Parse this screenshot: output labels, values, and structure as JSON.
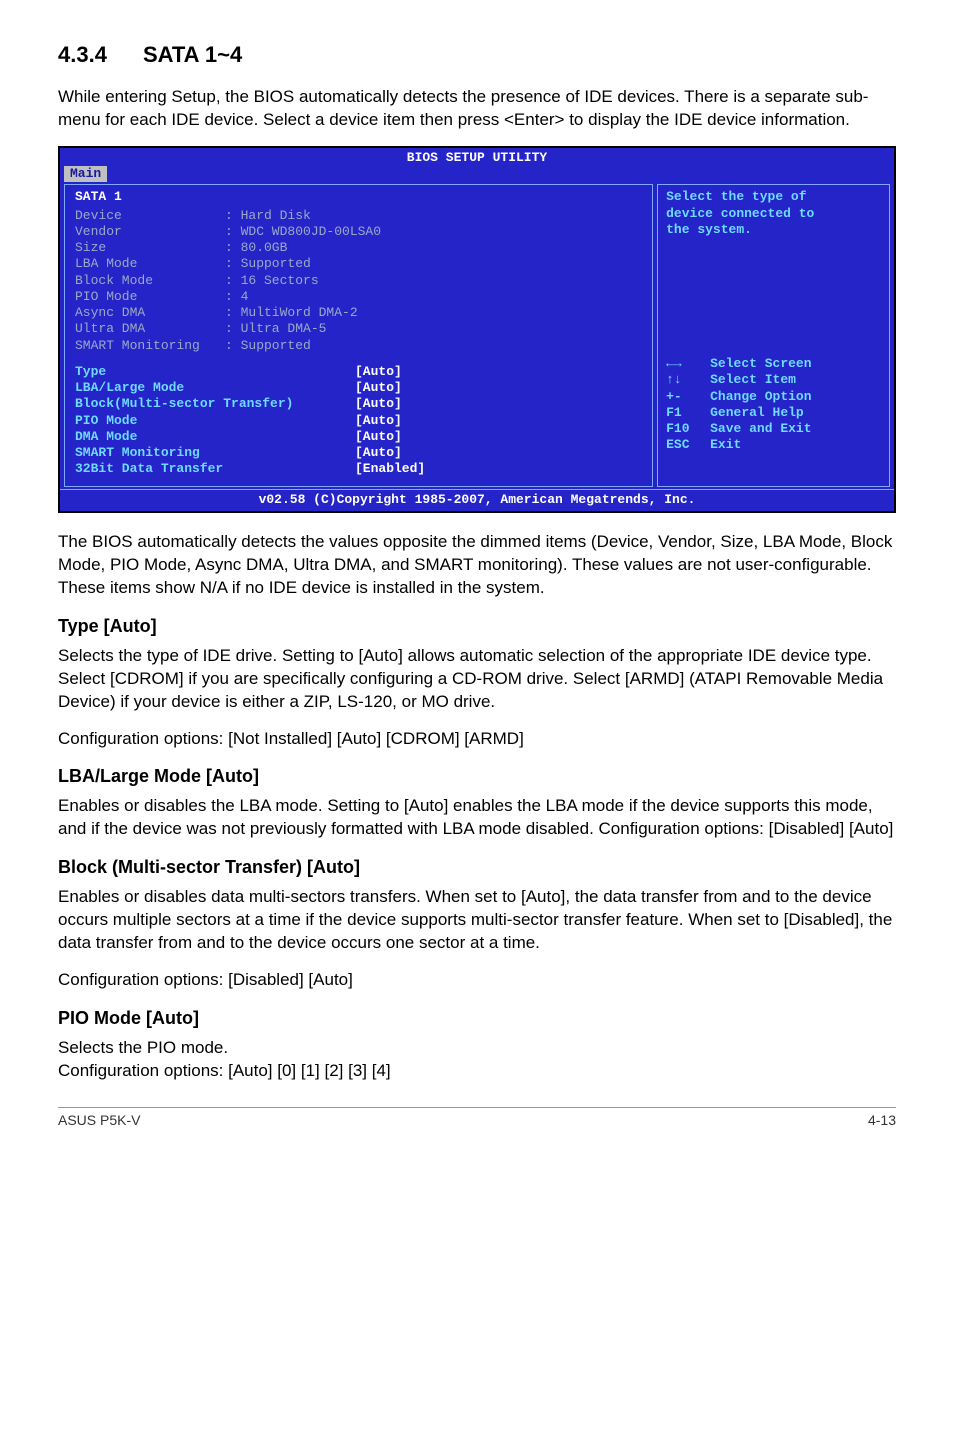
{
  "section": {
    "number": "4.3.4",
    "title": "SATA 1~4"
  },
  "intro": "While entering Setup, the BIOS automatically detects the presence of IDE devices. There is a separate sub-menu for each IDE device. Select a device item then press <Enter> to display the IDE device information.",
  "bios": {
    "title": "BIOS SETUP UTILITY",
    "tab": "Main",
    "panel_title": "SATA 1",
    "info_rows": [
      {
        "label": "Device",
        "value": ": Hard Disk"
      },
      {
        "label": "Vendor",
        "value": ": WDC WD800JD-00LSA0"
      },
      {
        "label": "Size",
        "value": ": 80.0GB"
      },
      {
        "label": "LBA Mode",
        "value": ": Supported"
      },
      {
        "label": "Block Mode",
        "value": ": 16 Sectors"
      },
      {
        "label": "PIO Mode",
        "value": ": 4"
      },
      {
        "label": "Async DMA",
        "value": ": MultiWord DMA-2"
      },
      {
        "label": "Ultra DMA",
        "value": ": Ultra DMA-5"
      },
      {
        "label": "SMART Monitoring",
        "value": ": Supported"
      }
    ],
    "fields": [
      {
        "label": "Type",
        "value": "[Auto]"
      },
      {
        "label": "LBA/Large Mode",
        "value": "[Auto]"
      },
      {
        "label": "Block(Multi-sector Transfer)",
        "value": "[Auto]"
      },
      {
        "label": "PIO Mode",
        "value": "[Auto]"
      },
      {
        "label": "DMA Mode",
        "value": "[Auto]"
      },
      {
        "label": "SMART Monitoring",
        "value": "[Auto]"
      },
      {
        "label": "32Bit Data Transfer",
        "value": "[Enabled]"
      }
    ],
    "side_hint": {
      "line1": "Select the type of",
      "line2": "device connected to",
      "line3": "the system."
    },
    "help": [
      {
        "key": "←→",
        "desc": "Select Screen"
      },
      {
        "key": "↑↓",
        "desc": "Select Item"
      },
      {
        "key": "+-",
        "desc": "Change Option"
      },
      {
        "key": "F1",
        "desc": "General Help"
      },
      {
        "key": "F10",
        "desc": "Save and Exit"
      },
      {
        "key": "ESC",
        "desc": "Exit"
      }
    ],
    "footer": "v02.58 (C)Copyright 1985-2007, American Megatrends, Inc."
  },
  "after_bios": "The BIOS automatically detects the values opposite the dimmed items (Device, Vendor, Size, LBA Mode, Block Mode, PIO Mode, Async DMA, Ultra DMA, and SMART monitoring). These values are not user-configurable. These items show N/A if no IDE device is installed in the system.",
  "type": {
    "heading": "Type [Auto]",
    "para": "Selects the type of IDE drive. Setting to [Auto] allows automatic selection of the appropriate IDE device type. Select [CDROM] if you are specifically configuring a CD-ROM drive. Select [ARMD] (ATAPI Removable Media Device) if your device is either a ZIP, LS-120, or MO drive.",
    "opts": "Configuration options: [Not Installed] [Auto] [CDROM] [ARMD]"
  },
  "lba": {
    "heading": "LBA/Large Mode [Auto]",
    "para": "Enables or disables the LBA mode. Setting to [Auto] enables the LBA mode if the device supports this mode, and if the device was not previously formatted with LBA mode disabled. Configuration options: [Disabled] [Auto]"
  },
  "block": {
    "heading": "Block (Multi-sector Transfer) [Auto]",
    "para": "Enables or disables data multi-sectors transfers. When set to [Auto], the data transfer from and to the device occurs multiple sectors at a time if the device supports multi-sector transfer feature. When set to [Disabled], the data transfer from and to the device occurs one sector at a time.",
    "opts": "Configuration options: [Disabled] [Auto]"
  },
  "pio": {
    "heading": "PIO Mode [Auto]",
    "para": "Selects the PIO mode.",
    "opts": "Configuration options: [Auto] [0] [1] [2] [3] [4]"
  },
  "footer": {
    "left": "ASUS P5K-V",
    "right": "4-13"
  }
}
